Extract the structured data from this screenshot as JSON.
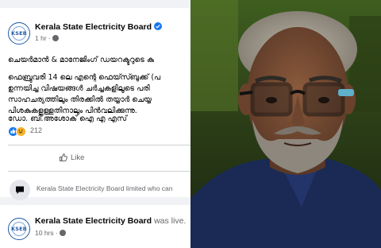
{
  "post": {
    "page_name": "Kerala State Electricity Board",
    "time": "1 hr",
    "logo_text": "KSEB",
    "lines": [
      "ചെയർമാൻ & മാനേജിംഗ് ഡയറക്ടറുടെ കു",
      "ഫെബ്രുവരി 14 ലെ എന്റെ ഫെയ്സ്ബുക്ക് (പ",
      "ഉന്നയിച്ച വിഷയങ്ങൾ ചർച്ചകളിലൂടെ പരി",
      "സാഹചര്യത്തിലും തിരക്കിൽ തയ്യാർ ചെയ്യ",
      "പിശകുകളുള്ളതിനാലും പിൻവലിക്കുന്നു."
    ],
    "signature": "ഡോ. ബി.അശോക് ഐ എ എസ്",
    "reaction_count": "212",
    "like_label": "Like",
    "comment_text": "Kerala State Electricity Board limited who can"
  },
  "second_post": {
    "page_name": "Kerala State Electricity Board",
    "status": "was live.",
    "time": "10 hrs",
    "logo_text": "KSEB"
  },
  "colors": {
    "facebook_blue": "#1877f2",
    "background": "#f0f2f5",
    "text_dark": "#050505",
    "text_meta": "#65676b",
    "glasses_frame": "#5fb0c9"
  },
  "icons": {
    "verified": "verified-icon",
    "globe": "globe-icon",
    "like": "thumbs-up-icon",
    "comment": "comment-icon"
  }
}
